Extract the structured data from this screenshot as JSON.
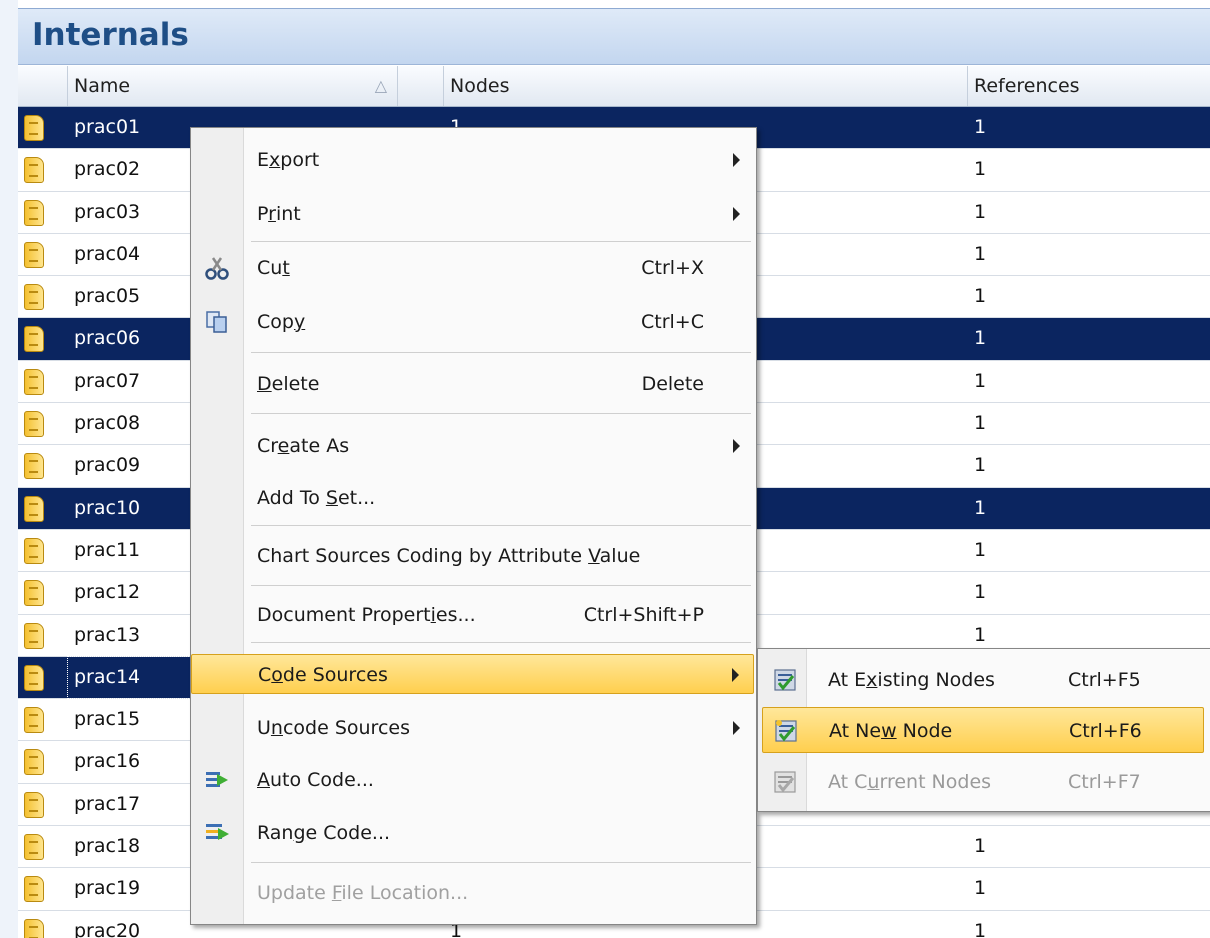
{
  "panel": {
    "title": "Internals",
    "columns": {
      "name": "Name",
      "sort": "△",
      "nodes": "Nodes",
      "references": "References"
    }
  },
  "rows": [
    {
      "name": "prac01",
      "nodes": "1",
      "refs": "1",
      "selected": true
    },
    {
      "name": "prac02",
      "nodes": "",
      "refs": "1",
      "selected": false
    },
    {
      "name": "prac03",
      "nodes": "",
      "refs": "1",
      "selected": false
    },
    {
      "name": "prac04",
      "nodes": "",
      "refs": "1",
      "selected": false
    },
    {
      "name": "prac05",
      "nodes": "",
      "refs": "1",
      "selected": false
    },
    {
      "name": "prac06",
      "nodes": "",
      "refs": "1",
      "selected": true
    },
    {
      "name": "prac07",
      "nodes": "",
      "refs": "1",
      "selected": false
    },
    {
      "name": "prac08",
      "nodes": "",
      "refs": "1",
      "selected": false
    },
    {
      "name": "prac09",
      "nodes": "",
      "refs": "1",
      "selected": false
    },
    {
      "name": "prac10",
      "nodes": "",
      "refs": "1",
      "selected": true
    },
    {
      "name": "prac11",
      "nodes": "",
      "refs": "1",
      "selected": false
    },
    {
      "name": "prac12",
      "nodes": "",
      "refs": "1",
      "selected": false
    },
    {
      "name": "prac13",
      "nodes": "",
      "refs": "1",
      "selected": false
    },
    {
      "name": "prac14",
      "nodes": "",
      "refs": "",
      "selected": true,
      "focused": true
    },
    {
      "name": "prac15",
      "nodes": "",
      "refs": "",
      "selected": false
    },
    {
      "name": "prac16",
      "nodes": "",
      "refs": "",
      "selected": false
    },
    {
      "name": "prac17",
      "nodes": "",
      "refs": "",
      "selected": false
    },
    {
      "name": "prac18",
      "nodes": "",
      "refs": "1",
      "selected": false
    },
    {
      "name": "prac19",
      "nodes": "",
      "refs": "1",
      "selected": false
    },
    {
      "name": "prac20",
      "nodes": "1",
      "refs": "1",
      "selected": false
    }
  ],
  "menu": {
    "export": {
      "pre": "E",
      "ul": "x",
      "post": "port"
    },
    "print": {
      "pre": "P",
      "ul": "r",
      "post": "int"
    },
    "cut": {
      "pre": "Cu",
      "ul": "t",
      "post": "",
      "shortcut": "Ctrl+X"
    },
    "copy": {
      "pre": "Cop",
      "ul": "y",
      "post": "",
      "shortcut": "Ctrl+C"
    },
    "delete": {
      "pre": "",
      "ul": "D",
      "post": "elete",
      "shortcut": "Delete"
    },
    "create_as": {
      "pre": "Cr",
      "ul": "e",
      "post": "ate As"
    },
    "add_to_set": {
      "pre": "Add To ",
      "ul": "S",
      "post": "et..."
    },
    "chart_sources": {
      "pre": "Chart Sources Coding by Attribute ",
      "ul": "V",
      "post": "alue"
    },
    "doc_props": {
      "pre": "Document Propert",
      "ul": "i",
      "post": "es...",
      "shortcut": "Ctrl+Shift+P"
    },
    "code_sources": {
      "pre": "C",
      "ul": "o",
      "post": "de Sources"
    },
    "uncode_sources": {
      "pre": "U",
      "ul": "n",
      "post": "code Sources"
    },
    "auto_code": {
      "pre": "",
      "ul": "A",
      "post": "uto Code..."
    },
    "range_code": {
      "pre": "Ran",
      "ul": "g",
      "post": "e Code..."
    },
    "update_file": {
      "pre": "Update ",
      "ul": "F",
      "post": "ile Location..."
    }
  },
  "submenu": {
    "existing": {
      "pre": "At E",
      "ul": "x",
      "post": "isting Nodes",
      "shortcut": "Ctrl+F5"
    },
    "new": {
      "pre": "At Ne",
      "ul": "w",
      "post": " Node",
      "shortcut": "Ctrl+F6"
    },
    "current": {
      "pre": "At C",
      "ul": "u",
      "post": "rrent Nodes",
      "shortcut": "Ctrl+F7"
    }
  },
  "icons": {
    "document": "document-icon",
    "cut": "scissors-icon",
    "copy": "copy-icon",
    "auto_code": "auto-code-icon",
    "range_code": "range-code-icon",
    "code_existing": "code-existing-icon",
    "code_new": "code-new-icon",
    "code_current": "code-current-icon"
  }
}
